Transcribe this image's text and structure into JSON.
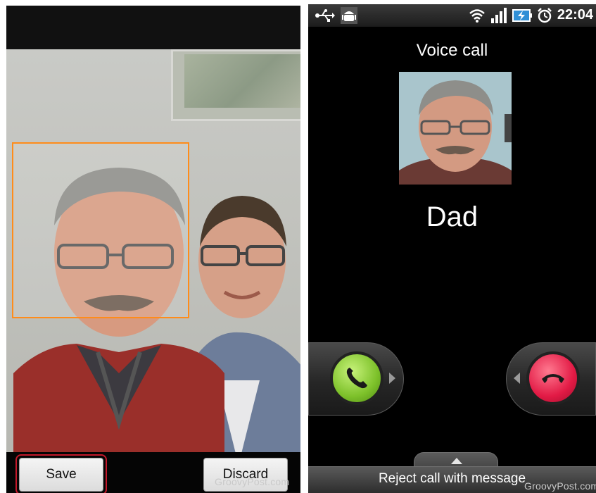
{
  "left_screen": {
    "save_label": "Save",
    "discard_label": "Discard",
    "watermark": "GroovyPost.com"
  },
  "right_screen": {
    "status_time": "22:04",
    "call_title": "Voice call",
    "caller_name": "Dad",
    "reject_with_message_label": "Reject call with message",
    "watermark": "GroovyPost.com"
  },
  "icons": {
    "usb": "usb-icon",
    "debug": "android-debug-icon",
    "wifi": "wifi-icon",
    "signal": "signal-icon",
    "battery": "battery-charging-icon",
    "alarm": "alarm-icon",
    "answer": "phone-answer-icon",
    "reject": "phone-hangup-icon"
  },
  "colors": {
    "crop_box": "#ff8c1a",
    "save_highlight": "#c4182a",
    "answer_green": "#7dc12a",
    "reject_red": "#e21a45"
  }
}
